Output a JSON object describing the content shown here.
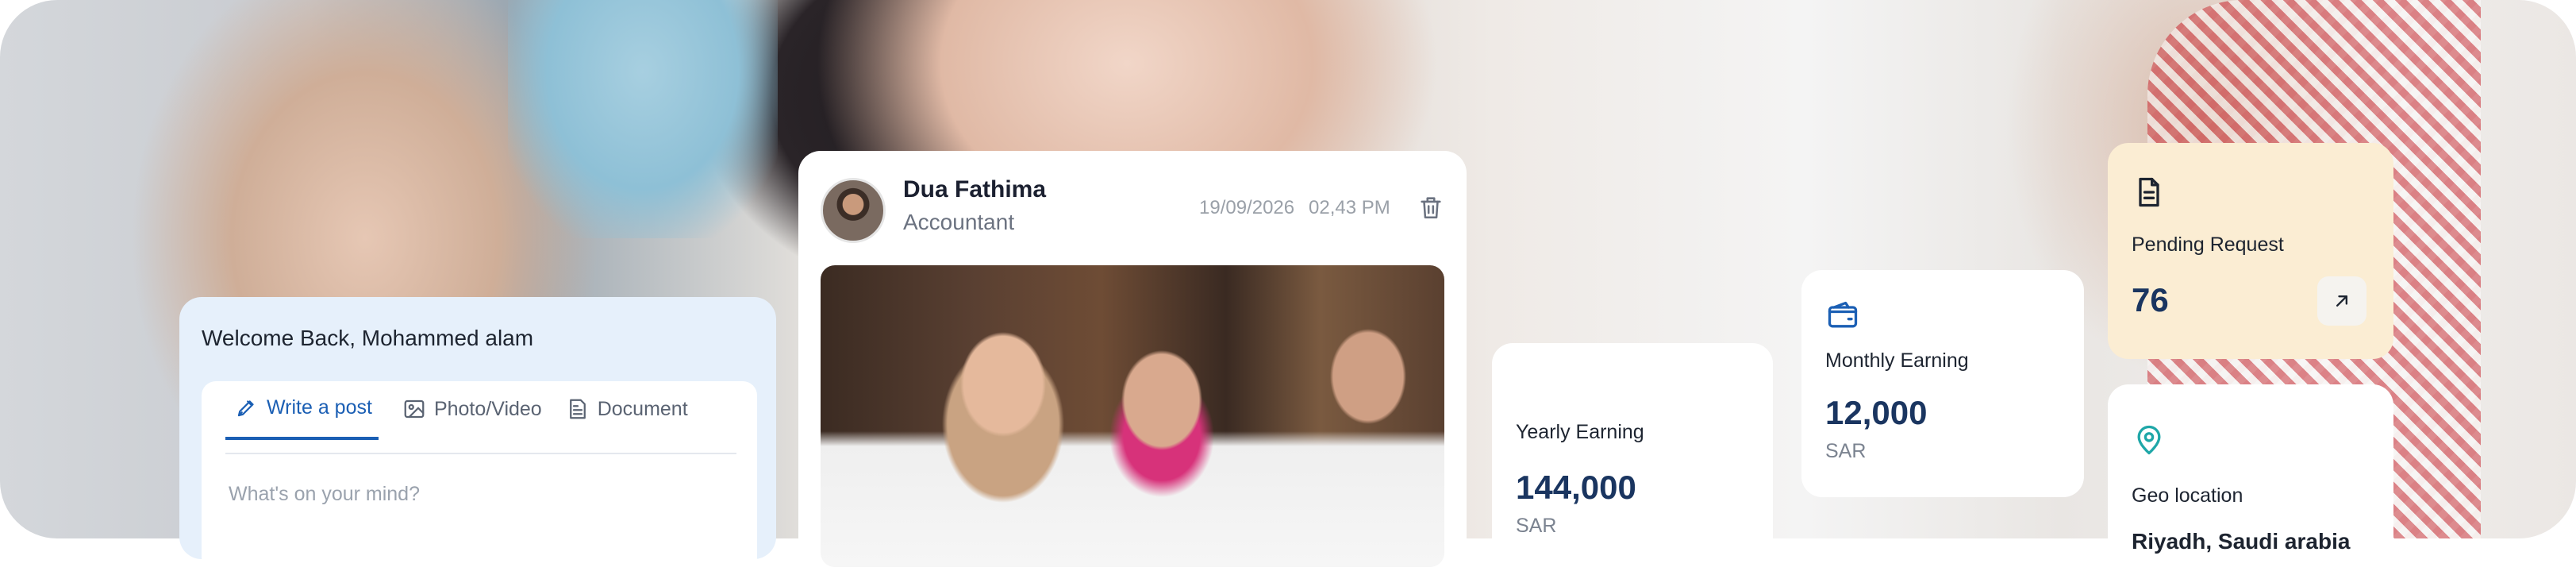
{
  "welcome": {
    "title": "Welcome Back, Mohammed alam",
    "tabs": [
      {
        "label": "Write a post",
        "icon": "pen-icon"
      },
      {
        "label": "Photo/Video",
        "icon": "image-icon"
      },
      {
        "label": "Document",
        "icon": "document-icon"
      }
    ],
    "placeholder": "What's on your mind?"
  },
  "post": {
    "name": "Dua Fathima",
    "role": "Accountant",
    "date": "19/09/2026",
    "time": "02,43 PM"
  },
  "yearly": {
    "label": "Yearly Earning",
    "value": "144,000",
    "unit": "SAR"
  },
  "monthly": {
    "label": "Monthly Earning",
    "value": "12,000",
    "unit": "SAR",
    "icon": "wallet-icon"
  },
  "pending": {
    "label": "Pending Request",
    "value": "76",
    "icon": "document-icon",
    "action_icon": "arrow-up-right-icon"
  },
  "geo": {
    "label": "Geo location",
    "icon": "map-pin-icon",
    "partial_text": "Riyadh, Saudi arabia"
  },
  "colors": {
    "accent": "#1b5fb4",
    "pending_bg": "#fbedd3",
    "value_text": "#1a3560",
    "geo_icon": "#1fa7a8"
  }
}
